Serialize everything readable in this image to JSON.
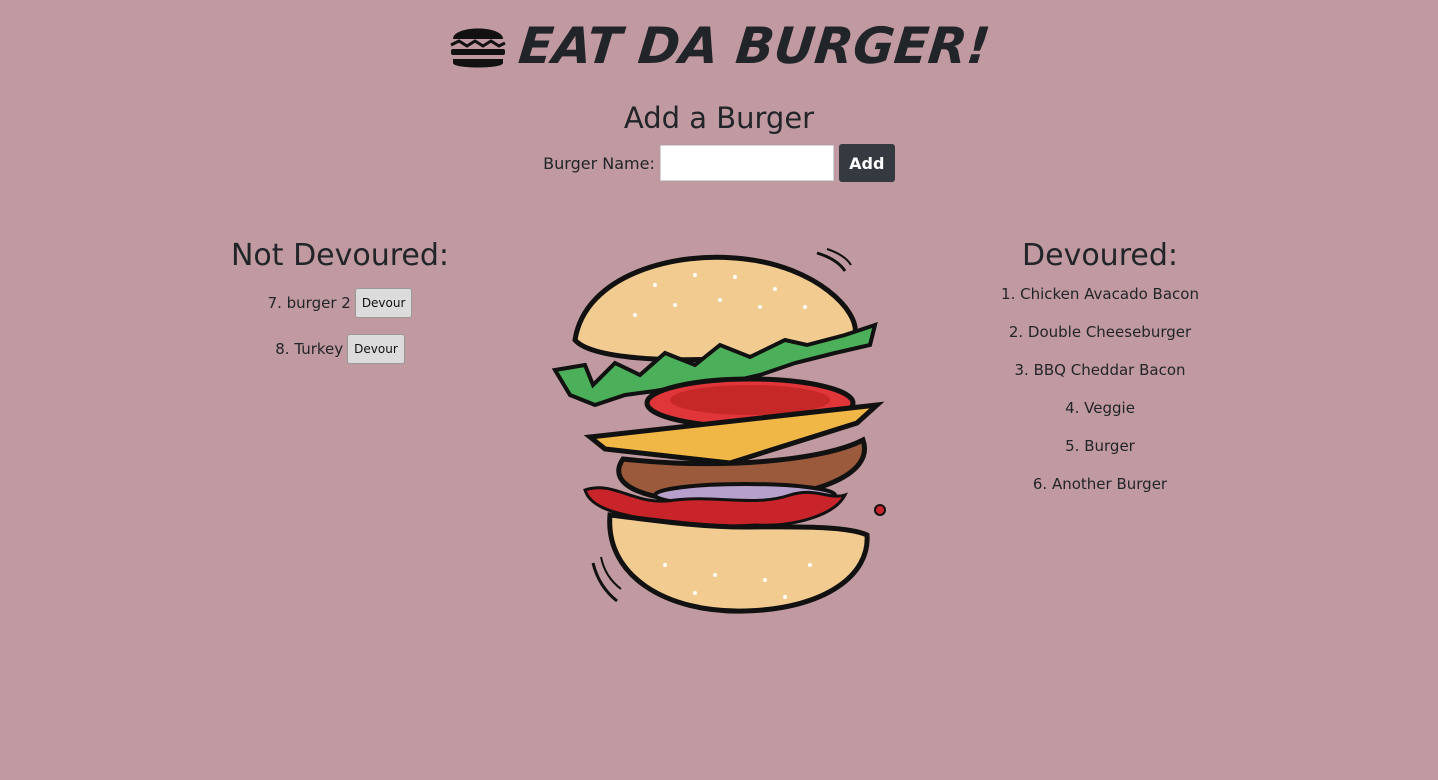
{
  "header": {
    "title": "EAT DA BURGER!",
    "logo_icon": "hamburger-icon"
  },
  "add_form": {
    "heading": "Add a Burger",
    "label": "Burger Name:",
    "input_value": "",
    "input_placeholder": "",
    "button_label": "Add"
  },
  "not_devoured": {
    "heading": "Not Devoured:",
    "items": [
      {
        "text": "7. burger 2",
        "button_label": "Devour"
      },
      {
        "text": "8. Turkey",
        "button_label": "Devour"
      }
    ]
  },
  "devoured": {
    "heading": "Devoured:",
    "items": [
      "1. Chicken Avacado Bacon",
      "2. Double Cheeseburger",
      "3. BBQ Cheddar Bacon",
      "4. Veggie",
      "5. Burger",
      "6. Another Burger"
    ]
  },
  "colors": {
    "background": "#c09aa0",
    "text": "#212529",
    "add_button": "#343a40",
    "devour_button": "#dcdcdc"
  },
  "illustration": "burger-illustration"
}
